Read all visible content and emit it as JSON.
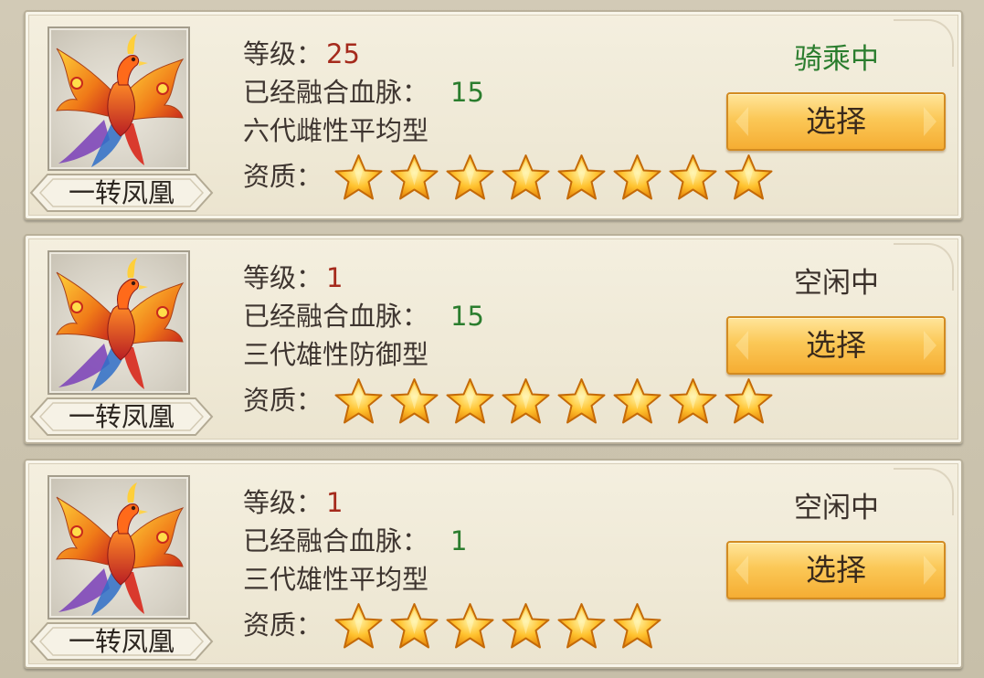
{
  "labels": {
    "level": "等级：",
    "blood": "已经融合血脉：",
    "quality": "资质："
  },
  "colors": {
    "level_value": "#a52a1c",
    "blood_value": "#2b7d2e",
    "status_riding": "#2b7d2e",
    "status_idle": "#3a302a",
    "button_gold": "#fbc857"
  },
  "mounts": [
    {
      "name": "一转凤凰",
      "level": "25",
      "blood": "15",
      "type": "六代雌性平均型",
      "stars": 8,
      "status": "骑乘中",
      "status_kind": "riding",
      "button_label": "选择",
      "icon": "phoenix-icon"
    },
    {
      "name": "一转凤凰",
      "level": "1",
      "blood": "15",
      "type": "三代雄性防御型",
      "stars": 8,
      "status": "空闲中",
      "status_kind": "idle",
      "button_label": "选择",
      "icon": "phoenix-icon"
    },
    {
      "name": "一转凤凰",
      "level": "1",
      "blood": "1",
      "type": "三代雄性平均型",
      "stars": 6,
      "status": "空闲中",
      "status_kind": "idle",
      "button_label": "选择",
      "icon": "phoenix-icon"
    }
  ]
}
